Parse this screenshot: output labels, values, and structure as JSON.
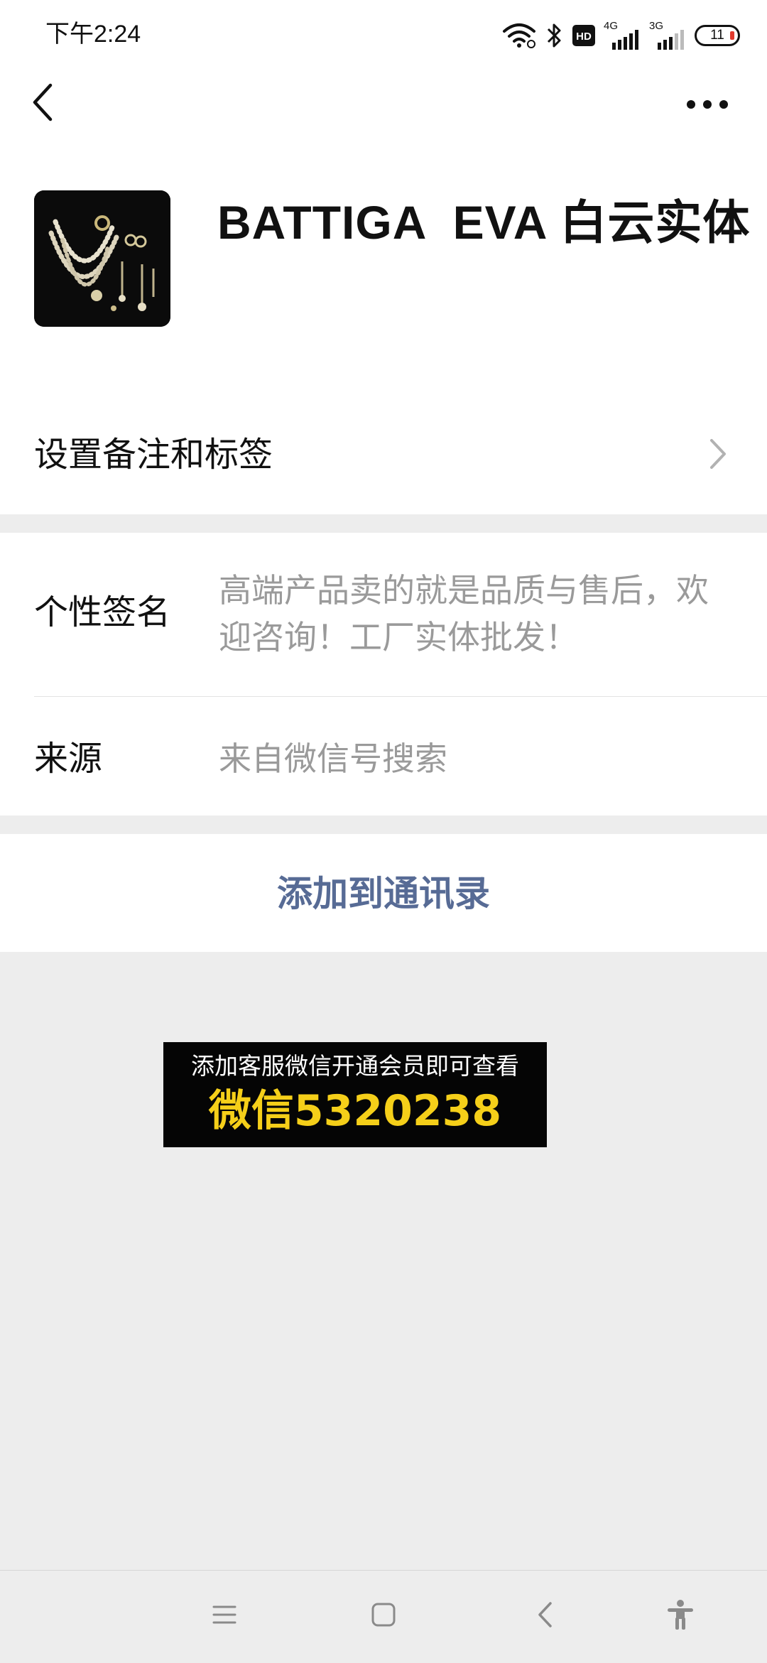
{
  "status_bar": {
    "time": "下午2:24",
    "hd_badge": "HD",
    "network1": "4G",
    "network2": "3G",
    "battery": "11",
    "battery_low_color": "#e03a2e"
  },
  "header": {
    "back_icon": "chevron-left-icon",
    "more_icon": "more-dots-icon"
  },
  "profile": {
    "avatar_alt": "jewelry-avatar",
    "name": "BATTIGA  EVA 白云实体"
  },
  "remark": {
    "label": "设置备注和标签",
    "icon": "chevron-right-icon"
  },
  "info": {
    "signature_label": "个性签名",
    "signature_value": "高端产品卖的就是品质与售后，欢迎咨询！工厂实体批发！",
    "source_label": "来源",
    "source_value": "来自微信号搜索"
  },
  "actions": {
    "add_contact": "添加到通讯录",
    "accent_color": "#576b95"
  },
  "promo": {
    "line1": "添加客服微信开通会员即可查看",
    "line2": "微信5320238",
    "highlight_color": "#f5cf19"
  },
  "nav": {
    "menu_icon": "menu-icon",
    "home_icon": "home-square-icon",
    "back_icon": "back-triangle-icon",
    "accessibility_icon": "accessibility-icon"
  }
}
